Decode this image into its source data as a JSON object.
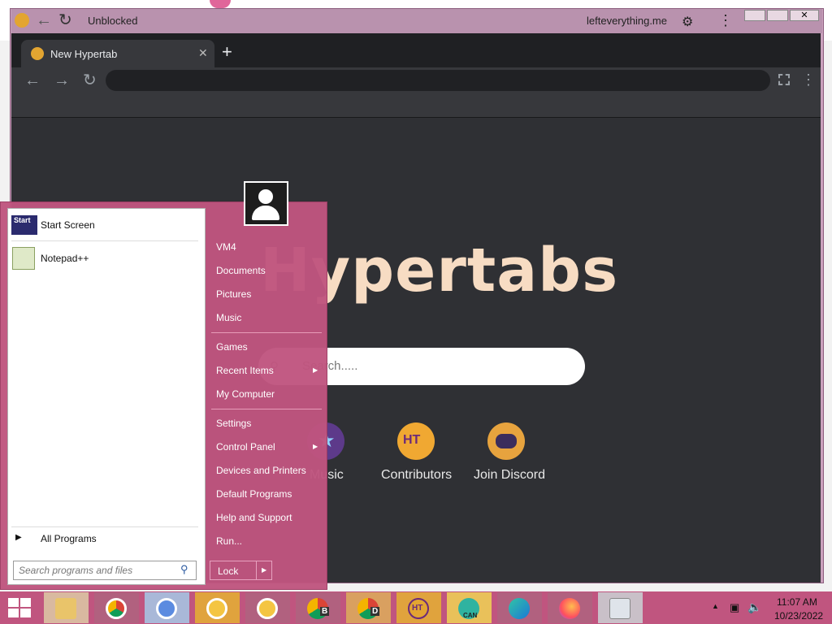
{
  "host": {
    "tab_title": "Unblocked",
    "url": "lefteverything.me"
  },
  "browser": {
    "tab_title": "New Hypertab",
    "new_tab_symbol": "+",
    "address_value": ""
  },
  "hypertabs": {
    "title": "Hypertabs",
    "search_placeholder": "Search.....",
    "shortcuts": [
      {
        "label": "Music",
        "icon": "star-icon"
      },
      {
        "label": "Contributors",
        "icon": "ht-logo-icon"
      },
      {
        "label": "Join Discord",
        "icon": "discord-icon"
      }
    ]
  },
  "start_menu": {
    "pinned": [
      {
        "label": "Start Screen",
        "icon_text": "Start"
      },
      {
        "label": "Notepad++"
      }
    ],
    "all_programs": "All Programs",
    "search_placeholder": "Search programs and files",
    "right_items_1": [
      "VM4",
      "Documents",
      "Pictures",
      "Music"
    ],
    "right_items_2": [
      "Games",
      "Recent Items",
      "My Computer"
    ],
    "right_items_3": [
      "Settings",
      "Control Panel",
      "Devices and Printers",
      "Default Programs",
      "Help and Support",
      "Run..."
    ],
    "lock_label": "Lock"
  },
  "taskbar": {
    "time": "11:07 AM",
    "date": "10/23/2022",
    "badge_b": "B",
    "badge_d": "D",
    "badge_ht": "HT",
    "badge_can": "CAN"
  },
  "colors": {
    "accent": "#c0557f",
    "title_text": "#f7dcc3"
  }
}
